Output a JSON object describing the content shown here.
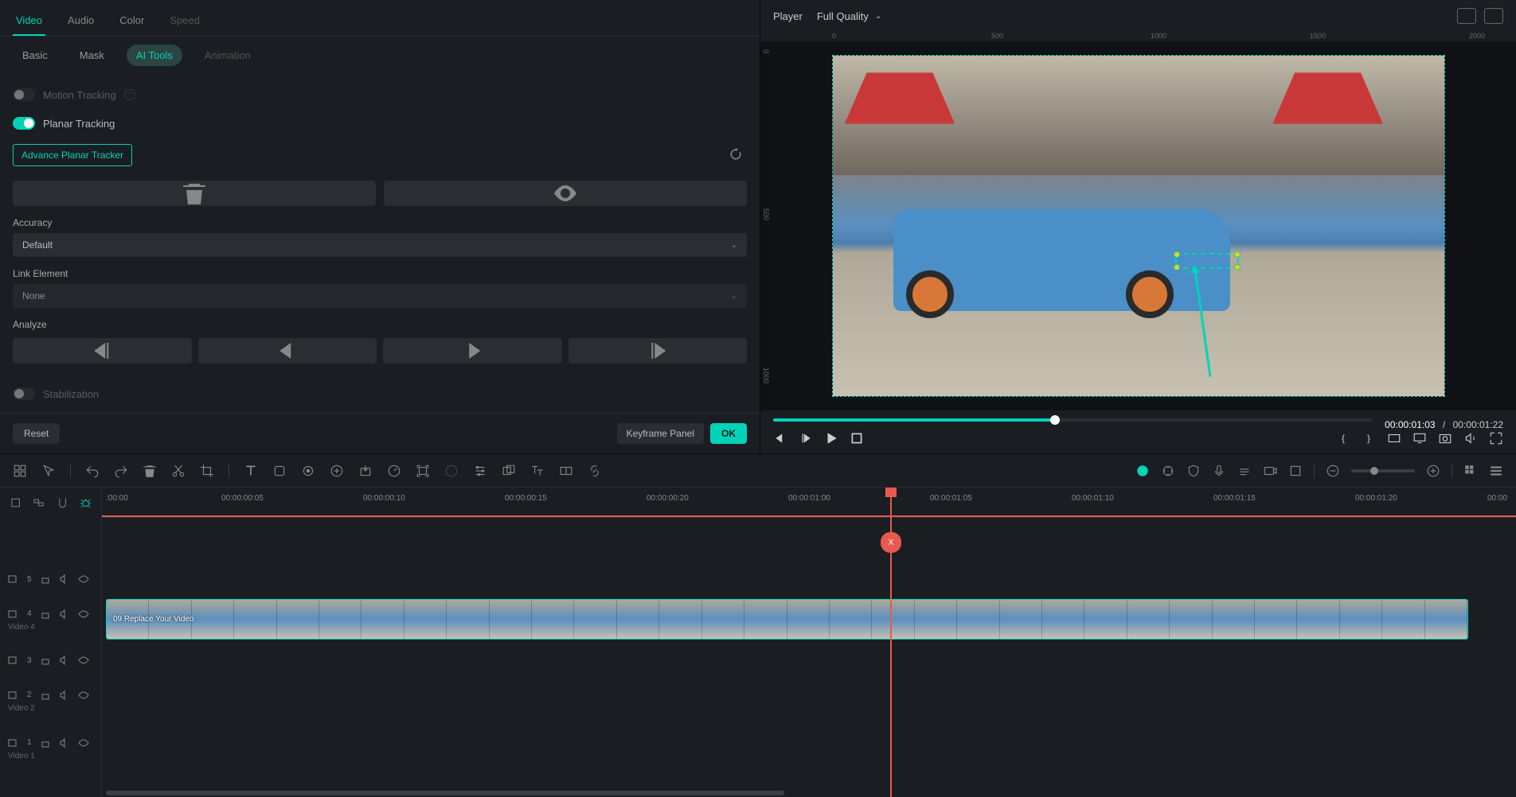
{
  "tabs_primary": {
    "video": "Video",
    "audio": "Audio",
    "color": "Color",
    "speed": "Speed"
  },
  "tabs_secondary": {
    "basic": "Basic",
    "mask": "Mask",
    "ai_tools": "AI Tools",
    "animation": "Animation"
  },
  "panel": {
    "motion_tracking": "Motion Tracking",
    "planar_tracking": "Planar Tracking",
    "advance_planar_tracker": "Advance Planar Tracker",
    "accuracy_label": "Accuracy",
    "accuracy_value": "Default",
    "link_element_label": "Link Element",
    "link_element_value": "None",
    "analyze_label": "Analyze",
    "stabilization": "Stabilization",
    "reset": "Reset",
    "keyframe_panel": "Keyframe Panel",
    "ok": "OK"
  },
  "player": {
    "label": "Player",
    "quality": "Full Quality",
    "time_current": "00:00:01:03",
    "time_separator": "/",
    "time_total": "00:00:01:22",
    "ruler_marks": [
      "0",
      "500",
      "1000",
      "1500",
      "2000"
    ],
    "ruler_left_marks": [
      "0",
      "500",
      "1000"
    ]
  },
  "timeline": {
    "ruler_marks": [
      ":00:00",
      "00:00:00:05",
      "00:00:00:10",
      "00:00:00:15",
      "00:00:00:20",
      "00:00:01:00",
      "00:00:01:05",
      "00:00:01:10",
      "00:00:01:15",
      "00:00:01:20",
      "00:00"
    ],
    "playhead_label": "X",
    "tracks": [
      {
        "num": "5",
        "name": ""
      },
      {
        "num": "4",
        "name": "Video 4"
      },
      {
        "num": "3",
        "name": ""
      },
      {
        "num": "2",
        "name": "Video 2"
      },
      {
        "num": "1",
        "name": "Video 1"
      }
    ],
    "clip_label": "09 Replace Your Video"
  }
}
